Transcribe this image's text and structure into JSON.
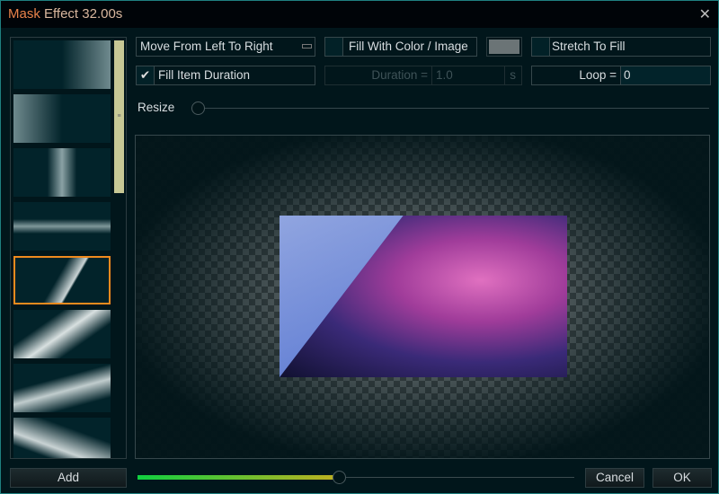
{
  "window": {
    "title_accent": "Mask",
    "title_rest": " Effect 32.00s",
    "close_icon": "close-icon"
  },
  "toolbar": {
    "direction": "Move From Left To Right",
    "fill_color": {
      "label": "Fill With Color / Image",
      "checked": false,
      "swatch": "#6b7476"
    },
    "stretch": {
      "label": "Stretch To Fill",
      "checked": false
    },
    "fill_duration": {
      "label": "Fill Item Duration",
      "checked": true,
      "check": "✔"
    },
    "duration": {
      "label": "Duration =",
      "value": "1.0",
      "unit": "s"
    },
    "loop": {
      "label": "Loop =",
      "value": "0"
    },
    "resize_label": "Resize",
    "resize_value": 0
  },
  "thumbnails": {
    "selected_index": 4,
    "scrollbar_grip": "≡"
  },
  "footer": {
    "add": "Add",
    "cancel": "Cancel",
    "ok": "OK",
    "progress_percent": 46
  },
  "colors": {
    "accent": "#f08a1e",
    "border": "#1f8080"
  }
}
